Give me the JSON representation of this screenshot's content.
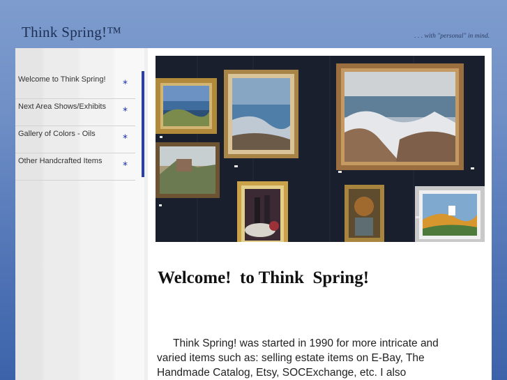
{
  "header": {
    "site_title": "Think Spring!™",
    "tagline": ". . . with \"personal\" in mind."
  },
  "sidebar": {
    "items": [
      {
        "label": "Welcome to Think Spring!",
        "icon": "asterisk-icon"
      },
      {
        "label": "Next Area Shows/Exhibits",
        "icon": "asterisk-icon"
      },
      {
        "label": "Gallery of Colors - Oils",
        "icon": "asterisk-icon"
      },
      {
        "label": "Other Handcrafted Items",
        "icon": "asterisk-icon"
      }
    ],
    "star_glyph": "*"
  },
  "main": {
    "heading": "Welcome!  to Think  Spring!",
    "intro": "Think Spring! was started in 1990 for more intricate and varied items such as: selling estate items on E-Bay, The Handmade Catalog, Etsy, SOCExchange, etc.   I also"
  },
  "colors": {
    "background": "#4f73b5",
    "nav_star": "#1a2fb0",
    "rail": "#2a3fae"
  }
}
